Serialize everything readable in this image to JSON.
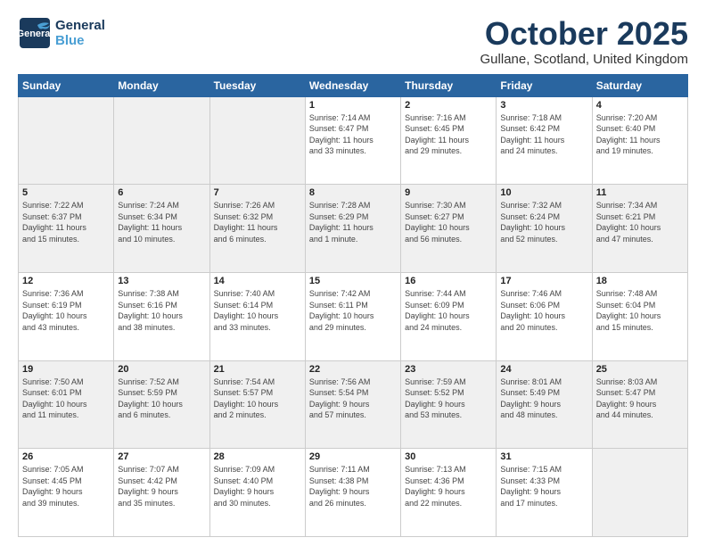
{
  "header": {
    "logo_general": "General",
    "logo_blue": "Blue",
    "month_title": "October 2025",
    "location": "Gullane, Scotland, United Kingdom"
  },
  "days_of_week": [
    "Sunday",
    "Monday",
    "Tuesday",
    "Wednesday",
    "Thursday",
    "Friday",
    "Saturday"
  ],
  "weeks": [
    [
      {
        "num": "",
        "info": ""
      },
      {
        "num": "",
        "info": ""
      },
      {
        "num": "",
        "info": ""
      },
      {
        "num": "1",
        "info": "Sunrise: 7:14 AM\nSunset: 6:47 PM\nDaylight: 11 hours\nand 33 minutes."
      },
      {
        "num": "2",
        "info": "Sunrise: 7:16 AM\nSunset: 6:45 PM\nDaylight: 11 hours\nand 29 minutes."
      },
      {
        "num": "3",
        "info": "Sunrise: 7:18 AM\nSunset: 6:42 PM\nDaylight: 11 hours\nand 24 minutes."
      },
      {
        "num": "4",
        "info": "Sunrise: 7:20 AM\nSunset: 6:40 PM\nDaylight: 11 hours\nand 19 minutes."
      }
    ],
    [
      {
        "num": "5",
        "info": "Sunrise: 7:22 AM\nSunset: 6:37 PM\nDaylight: 11 hours\nand 15 minutes."
      },
      {
        "num": "6",
        "info": "Sunrise: 7:24 AM\nSunset: 6:34 PM\nDaylight: 11 hours\nand 10 minutes."
      },
      {
        "num": "7",
        "info": "Sunrise: 7:26 AM\nSunset: 6:32 PM\nDaylight: 11 hours\nand 6 minutes."
      },
      {
        "num": "8",
        "info": "Sunrise: 7:28 AM\nSunset: 6:29 PM\nDaylight: 11 hours\nand 1 minute."
      },
      {
        "num": "9",
        "info": "Sunrise: 7:30 AM\nSunset: 6:27 PM\nDaylight: 10 hours\nand 56 minutes."
      },
      {
        "num": "10",
        "info": "Sunrise: 7:32 AM\nSunset: 6:24 PM\nDaylight: 10 hours\nand 52 minutes."
      },
      {
        "num": "11",
        "info": "Sunrise: 7:34 AM\nSunset: 6:21 PM\nDaylight: 10 hours\nand 47 minutes."
      }
    ],
    [
      {
        "num": "12",
        "info": "Sunrise: 7:36 AM\nSunset: 6:19 PM\nDaylight: 10 hours\nand 43 minutes."
      },
      {
        "num": "13",
        "info": "Sunrise: 7:38 AM\nSunset: 6:16 PM\nDaylight: 10 hours\nand 38 minutes."
      },
      {
        "num": "14",
        "info": "Sunrise: 7:40 AM\nSunset: 6:14 PM\nDaylight: 10 hours\nand 33 minutes."
      },
      {
        "num": "15",
        "info": "Sunrise: 7:42 AM\nSunset: 6:11 PM\nDaylight: 10 hours\nand 29 minutes."
      },
      {
        "num": "16",
        "info": "Sunrise: 7:44 AM\nSunset: 6:09 PM\nDaylight: 10 hours\nand 24 minutes."
      },
      {
        "num": "17",
        "info": "Sunrise: 7:46 AM\nSunset: 6:06 PM\nDaylight: 10 hours\nand 20 minutes."
      },
      {
        "num": "18",
        "info": "Sunrise: 7:48 AM\nSunset: 6:04 PM\nDaylight: 10 hours\nand 15 minutes."
      }
    ],
    [
      {
        "num": "19",
        "info": "Sunrise: 7:50 AM\nSunset: 6:01 PM\nDaylight: 10 hours\nand 11 minutes."
      },
      {
        "num": "20",
        "info": "Sunrise: 7:52 AM\nSunset: 5:59 PM\nDaylight: 10 hours\nand 6 minutes."
      },
      {
        "num": "21",
        "info": "Sunrise: 7:54 AM\nSunset: 5:57 PM\nDaylight: 10 hours\nand 2 minutes."
      },
      {
        "num": "22",
        "info": "Sunrise: 7:56 AM\nSunset: 5:54 PM\nDaylight: 9 hours\nand 57 minutes."
      },
      {
        "num": "23",
        "info": "Sunrise: 7:59 AM\nSunset: 5:52 PM\nDaylight: 9 hours\nand 53 minutes."
      },
      {
        "num": "24",
        "info": "Sunrise: 8:01 AM\nSunset: 5:49 PM\nDaylight: 9 hours\nand 48 minutes."
      },
      {
        "num": "25",
        "info": "Sunrise: 8:03 AM\nSunset: 5:47 PM\nDaylight: 9 hours\nand 44 minutes."
      }
    ],
    [
      {
        "num": "26",
        "info": "Sunrise: 7:05 AM\nSunset: 4:45 PM\nDaylight: 9 hours\nand 39 minutes."
      },
      {
        "num": "27",
        "info": "Sunrise: 7:07 AM\nSunset: 4:42 PM\nDaylight: 9 hours\nand 35 minutes."
      },
      {
        "num": "28",
        "info": "Sunrise: 7:09 AM\nSunset: 4:40 PM\nDaylight: 9 hours\nand 30 minutes."
      },
      {
        "num": "29",
        "info": "Sunrise: 7:11 AM\nSunset: 4:38 PM\nDaylight: 9 hours\nand 26 minutes."
      },
      {
        "num": "30",
        "info": "Sunrise: 7:13 AM\nSunset: 4:36 PM\nDaylight: 9 hours\nand 22 minutes."
      },
      {
        "num": "31",
        "info": "Sunrise: 7:15 AM\nSunset: 4:33 PM\nDaylight: 9 hours\nand 17 minutes."
      },
      {
        "num": "",
        "info": ""
      }
    ]
  ]
}
